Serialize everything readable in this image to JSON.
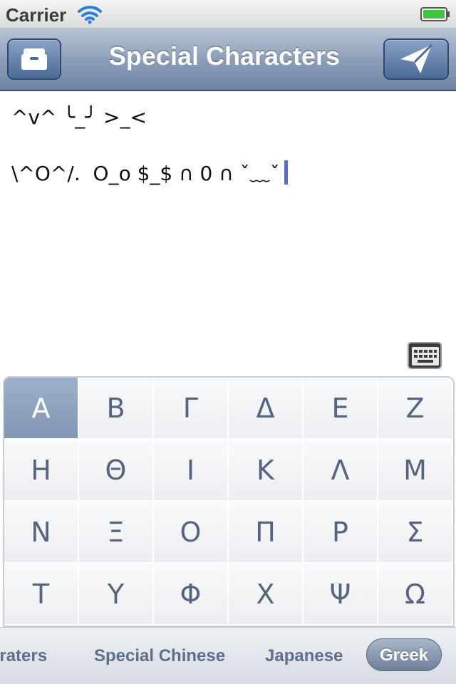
{
  "status_bar": {
    "carrier": "Carrier"
  },
  "nav": {
    "title": "Special Characters",
    "left_icon": "archive-icon",
    "right_icon": "send-icon"
  },
  "text": {
    "line1": "^v^ ╰_╯ >_<",
    "line2": "\\^O^/.  O_o $_$ ∩ 0 ∩ ˇ﹏ˇ"
  },
  "keyboard_toggle_icon": "keyboard-icon",
  "grid": {
    "selected": "Α",
    "cells": [
      "Α",
      "Β",
      "Γ",
      "Δ",
      "Ε",
      "Ζ",
      "Η",
      "Θ",
      "Ι",
      "Κ",
      "Λ",
      "Μ",
      "Ν",
      "Ξ",
      "Ο",
      "Π",
      "Ρ",
      "Σ",
      "Τ",
      "Υ",
      "Φ",
      "Χ",
      "Ψ",
      "Ω"
    ]
  },
  "tabs": [
    {
      "label": "arater s"
    },
    {
      "label": "Special Chinese"
    },
    {
      "label": "Japanese"
    },
    {
      "label": "Greek",
      "active": true
    }
  ]
}
